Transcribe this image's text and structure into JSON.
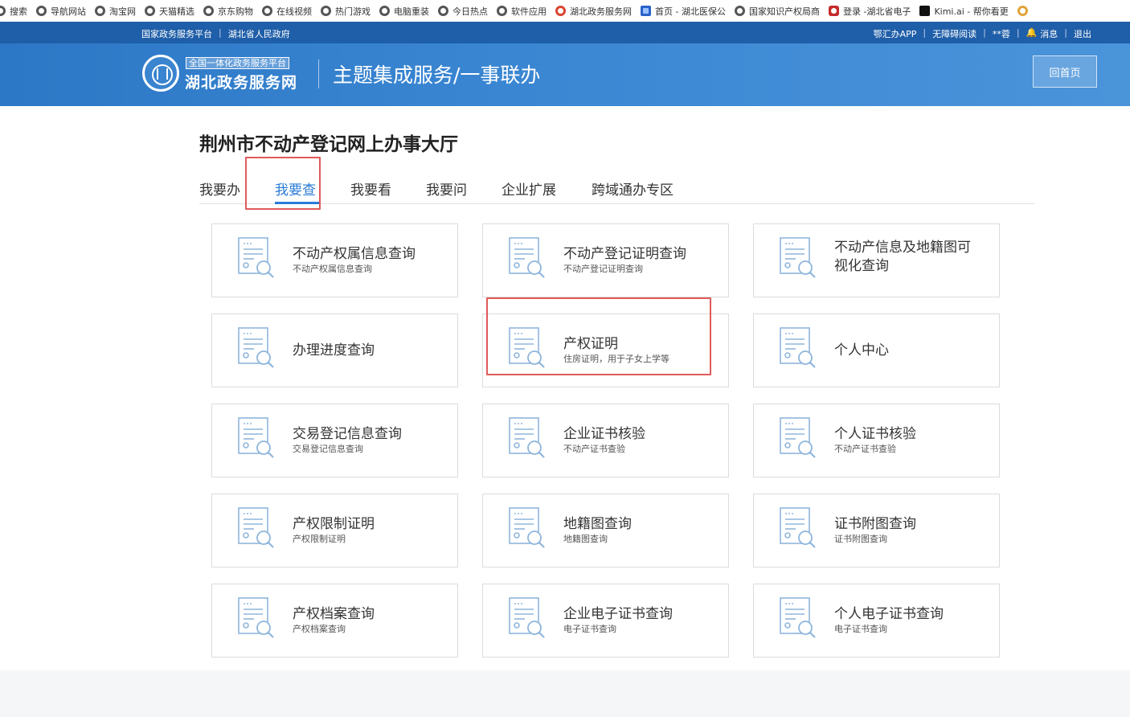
{
  "bookmarks": [
    {
      "label": "搜索",
      "icon": "globe-icon"
    },
    {
      "label": "导航网站",
      "icon": "globe-icon"
    },
    {
      "label": "淘宝网",
      "icon": "globe-icon"
    },
    {
      "label": "天猫精选",
      "icon": "globe-icon"
    },
    {
      "label": "京东购物",
      "icon": "globe-icon"
    },
    {
      "label": "在线视频",
      "icon": "globe-icon"
    },
    {
      "label": "热门游戏",
      "icon": "globe-icon"
    },
    {
      "label": "电脑重装",
      "icon": "globe-icon"
    },
    {
      "label": "今日热点",
      "icon": "globe-icon"
    },
    {
      "label": "软件应用",
      "icon": "globe-icon"
    },
    {
      "label": "湖北政务服务网",
      "icon": "hubei-logo-icon"
    },
    {
      "label": "首页 - 湖北医保公",
      "icon": "chs-logo-icon"
    },
    {
      "label": "国家知识产权局商",
      "icon": "globe-icon"
    },
    {
      "label": "登录 -湖北省电子",
      "icon": "emblem-icon"
    },
    {
      "label": "Kimi.ai - 帮你看更",
      "icon": "kimi-logo-icon"
    }
  ],
  "top_strip": {
    "left": [
      "国家政务服务平台",
      "湖北省人民政府"
    ],
    "right": [
      "鄂汇办APP",
      "无障碍阅读",
      "**蓉",
      "消息",
      "退出"
    ]
  },
  "banner": {
    "logo_tag": "全国一体化政务服务平台",
    "logo_name": "湖北政务服务网",
    "title": "主题集成服务/一事联办",
    "home_button": "回首页"
  },
  "main": {
    "page_title": "荆州市不动产登记网上办事大厅",
    "tabs": [
      "我要办",
      "我要查",
      "我要看",
      "我要问",
      "企业扩展",
      "跨域通办专区"
    ],
    "active_tab": "我要查",
    "cards": [
      {
        "title": "不动产权属信息查询",
        "subtitle": "不动产权属信息查询"
      },
      {
        "title": "不动产登记证明查询",
        "subtitle": "不动产登记证明查询"
      },
      {
        "title": "不动产信息及地籍图可视化查询",
        "subtitle": ""
      },
      {
        "title": "办理进度查询",
        "subtitle": ""
      },
      {
        "title": "产权证明",
        "subtitle": "住房证明，用于子女上学等"
      },
      {
        "title": "个人中心",
        "subtitle": ""
      },
      {
        "title": "交易登记信息查询",
        "subtitle": "交易登记信息查询"
      },
      {
        "title": "企业证书核验",
        "subtitle": "不动产证书查验"
      },
      {
        "title": "个人证书核验",
        "subtitle": "不动产证书查验"
      },
      {
        "title": "产权限制证明",
        "subtitle": "产权限制证明"
      },
      {
        "title": "地籍图查询",
        "subtitle": "地籍图查询"
      },
      {
        "title": "证书附图查询",
        "subtitle": "证书附图查询"
      },
      {
        "title": "产权档案查询",
        "subtitle": "产权档案查询"
      },
      {
        "title": "企业电子证书查询",
        "subtitle": "电子证书查询"
      },
      {
        "title": "个人电子证书查询",
        "subtitle": "电子证书查询"
      }
    ]
  },
  "colors": {
    "accent": "#2a7bd7",
    "banner": "#2c78c6",
    "highlight": "#e05a5a"
  }
}
